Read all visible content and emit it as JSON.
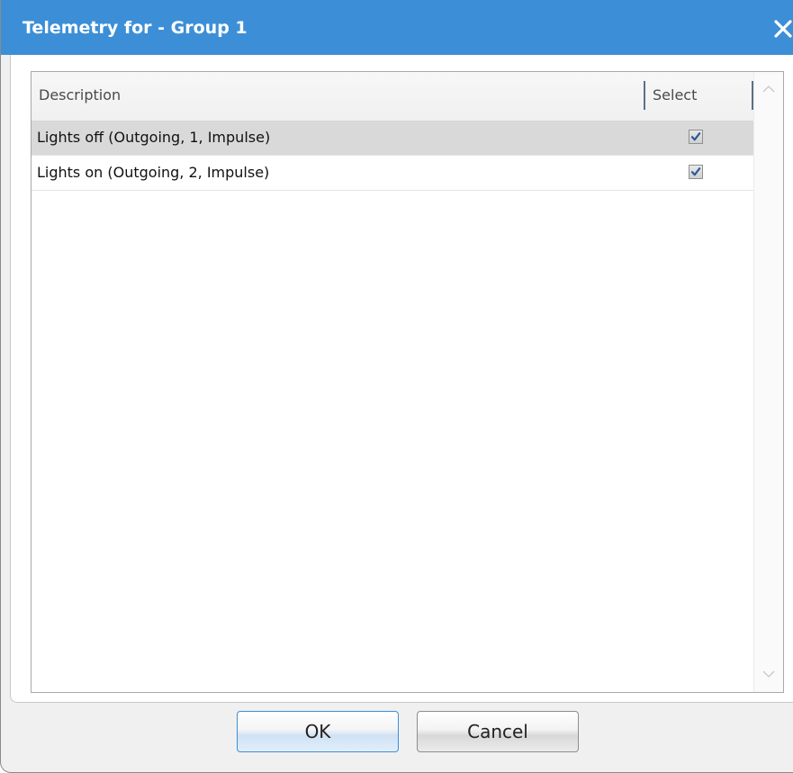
{
  "window": {
    "title": "Telemetry for - Group 1",
    "close_icon": "close-icon"
  },
  "grid": {
    "columns": [
      "Description",
      "Select"
    ],
    "rows": [
      {
        "description": "Lights off (Outgoing, 1, Impulse)",
        "selected": true,
        "checked": true
      },
      {
        "description": "Lights on (Outgoing, 2, Impulse)",
        "selected": false,
        "checked": true
      }
    ]
  },
  "buttons": {
    "ok": "OK",
    "cancel": "Cancel"
  },
  "colors": {
    "titlebar": "#3c8fd7",
    "selected_row": "#d9d9d9",
    "ok_border": "#3d8fd5"
  }
}
